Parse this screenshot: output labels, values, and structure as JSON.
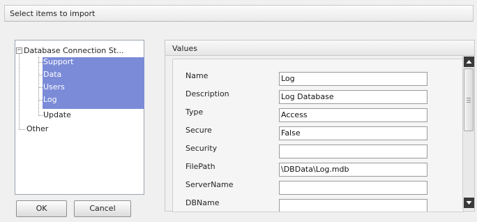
{
  "dialog": {
    "title": "Select items to import"
  },
  "tree": {
    "root_label": "Database Connection St...",
    "root_expander": "−",
    "children": [
      {
        "label": "Support",
        "selected": true
      },
      {
        "label": "Data",
        "selected": true
      },
      {
        "label": "Users",
        "selected": true
      },
      {
        "label": "Log",
        "selected": true
      },
      {
        "label": "Update",
        "selected": false
      }
    ],
    "other_label": "Other"
  },
  "buttons": {
    "ok": "OK",
    "cancel": "Cancel"
  },
  "values": {
    "header": "Values",
    "properties": [
      {
        "name": "Name",
        "value": "Log"
      },
      {
        "name": "Description",
        "value": "Log Database"
      },
      {
        "name": "Type",
        "value": "Access"
      },
      {
        "name": "Secure",
        "value": "False"
      },
      {
        "name": "Security",
        "value": ""
      },
      {
        "name": "FilePath",
        "value": "\\DBData\\Log.mdb"
      },
      {
        "name": "ServerName",
        "value": ""
      },
      {
        "name": "DBName",
        "value": ""
      }
    ]
  },
  "icons": {
    "scroll_up": "scroll-up-arrow-icon",
    "scroll_down": "scroll-down-arrow-icon"
  },
  "colors": {
    "selection": "#7b8bd8",
    "selection_text": "#ffffff"
  }
}
